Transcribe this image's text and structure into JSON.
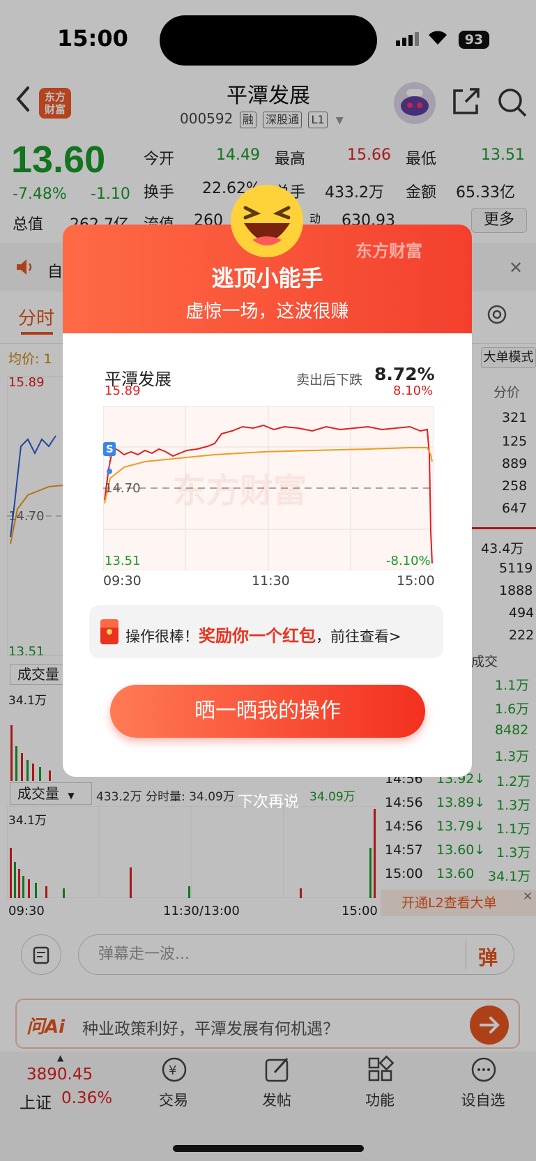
{
  "status_bar": {
    "time": "15:00",
    "battery": "93"
  },
  "header": {
    "logo_line1": "东方",
    "logo_line2": "财富",
    "title": "平潭发展",
    "code": "000592",
    "tags": [
      "融",
      "深股通",
      "L1"
    ]
  },
  "quote": {
    "price": "13.60",
    "change_pct": "-7.48%",
    "change": "-1.10",
    "rows": [
      [
        {
          "label": "今开",
          "value": "14.49"
        },
        {
          "label": "最高",
          "value": "15.66"
        },
        {
          "label": "最低",
          "value": "13.51"
        }
      ],
      [
        {
          "label": "换手",
          "value": "22.62%"
        },
        {
          "label": "总手",
          "value": "433.2万"
        },
        {
          "label": "金额",
          "value": "65.33亿"
        }
      ],
      [
        {
          "label": "总值",
          "value": "262.7亿"
        },
        {
          "label": "流值",
          "value": "260"
        },
        {
          "label": "动",
          "value": "630.93"
        }
      ]
    ],
    "more_button": "更多"
  },
  "notice_text": "自",
  "tabs": {
    "active": "分时"
  },
  "chart_bg": {
    "avg_label": "均价: 1",
    "high": "15.89",
    "low": "13.51",
    "mid": "14.70",
    "vol_label": "成交量",
    "vol_max": "34.1万",
    "time_start": "09:30",
    "time_mid": "11:30/13:00",
    "time_end": "15:00",
    "vol_info_1": "433.2万 分时量: 34.09万",
    "vol_info_2": "34.09万",
    "right_header": "分价",
    "depth_values": [
      "321",
      "125",
      "889",
      "258",
      "647"
    ],
    "big_rows": [
      "43.4万",
      "5119",
      "1888",
      "494",
      "222"
    ],
    "trade_header": "成交",
    "single_mode": "大单模式",
    "trades": [
      {
        "time": "",
        "price": "",
        "vol": "1.1万"
      },
      {
        "time": "",
        "price": "",
        "vol": "1.6万"
      },
      {
        "time": "",
        "price": "",
        "vol": "8482"
      },
      {
        "time": "",
        "price": "",
        "vol": "1.3万"
      },
      {
        "time": "14:56",
        "price": "13.92↓",
        "vol": "1.2万"
      },
      {
        "time": "14:56",
        "price": "13.89↓",
        "vol": "1.3万"
      },
      {
        "time": "14:56",
        "price": "13.79↓",
        "vol": "1.1万"
      },
      {
        "time": "14:57",
        "price": "13.60↓",
        "vol": "1.3万"
      },
      {
        "time": "15:00",
        "price": "13.60",
        "vol": "34.1万"
      }
    ],
    "l2_banner": "开通L2查看大单"
  },
  "comment_placeholder": "弹幕走一波...",
  "danmaku_btn": "弹",
  "ai_bar": {
    "logo": "问Ai",
    "question": "种业政策利好，平潭发展有何机遇？"
  },
  "modal": {
    "brand": "东方财富",
    "title": "逃顶小能手",
    "subtitle": "虚惊一场，这波很赚",
    "stock": "平潭发展",
    "drop_label": "卖出后下跌",
    "drop_value": "8.72%",
    "chart_high": "15.89",
    "chart_high_pct": "8.10%",
    "chart_mid": "14.70",
    "chart_low": "13.51",
    "chart_low_pct": "-8.10%",
    "t_start": "09:30",
    "t_mid": "11:30",
    "t_end": "15:00",
    "watermark": "东方财富",
    "reward_prefix": "操作很棒！",
    "reward_highlight": "奖励你一个红包",
    "reward_suffix": "，前往查看>",
    "share_button": "晒一晒我的操作",
    "later": "下次再说"
  },
  "bottom_nav": {
    "index_value": "3890.45",
    "index_name": "上证",
    "index_pct": "0.36%",
    "items": [
      "交易",
      "发帖",
      "功能",
      "设自选"
    ]
  }
}
